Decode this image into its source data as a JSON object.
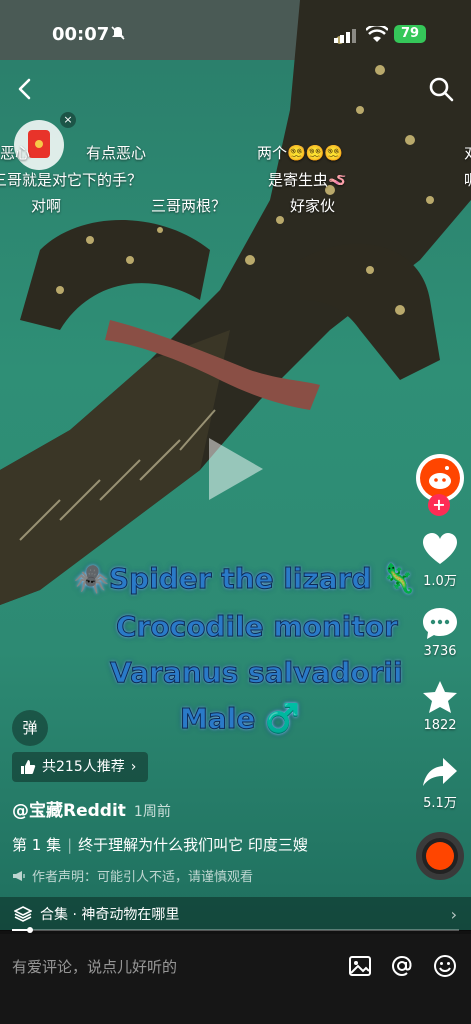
{
  "status_bar": {
    "time": "00:07",
    "battery": "79"
  },
  "danmu": [
    {
      "text": "恶心"
    },
    {
      "text": "有点恶心"
    },
    {
      "text": "两个😵‍💫😵‍💫😵‍💫"
    },
    {
      "text": "对"
    },
    {
      "text": "三哥就是对它下的手？"
    },
    {
      "text": "是寄生虫🪱"
    },
    {
      "text": "呢"
    },
    {
      "text": "对啊"
    },
    {
      "text": "三哥两根？"
    },
    {
      "text": "好家伙"
    }
  ],
  "video_caption": {
    "line1": "🕷️Spider the lizard 🦎",
    "line2": "Crocodile monitor",
    "line3": "Varanus salvadorii",
    "line4": "Male ♂️"
  },
  "actions": {
    "like_count": "1.0万",
    "comment_count": "3736",
    "favorite_count": "1822",
    "share_count": "5.1万"
  },
  "danmu_toggle": "弹",
  "recommend": {
    "label": "共215人推荐"
  },
  "author": {
    "name": "@宝藏Reddit",
    "time": "1周前"
  },
  "description": {
    "episode": "第 1 集",
    "title": "终于理解为什么我们叫它 印度三嫂"
  },
  "disclaimer": "作者声明：可能引人不适，请谨慎观看",
  "collection": {
    "label": "合集 · 神奇动物在哪里"
  },
  "progress": 0.04,
  "comment_bar": {
    "placeholder": "有爱评论，说点儿好听的"
  },
  "icons": [
    "back-icon",
    "search-icon",
    "bell-off-icon",
    "play-icon",
    "heart-icon",
    "comment-icon",
    "star-icon",
    "share-icon",
    "image-icon",
    "at-icon",
    "emoji-icon",
    "thumbs-up-icon",
    "layers-icon",
    "megaphone-icon"
  ],
  "colors": {
    "accent_red": "#fe2c55",
    "reddit_orange": "#ff4500",
    "battery_green": "#35c759"
  }
}
